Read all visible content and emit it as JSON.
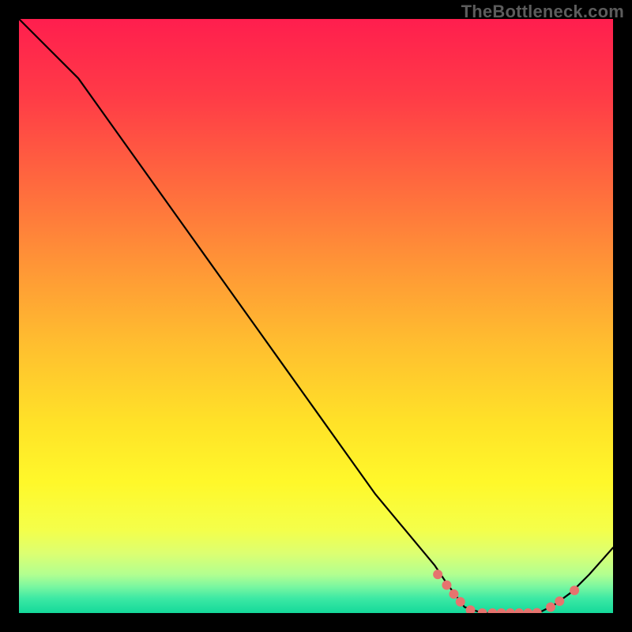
{
  "watermark": "TheBottleneck.com",
  "chart_data": {
    "type": "line",
    "title": "",
    "xlabel": "",
    "ylabel": "",
    "xlim": [
      0,
      100
    ],
    "ylim": [
      0,
      100
    ],
    "grid": false,
    "legend": false,
    "series": [
      {
        "name": "curve",
        "x": [
          0,
          5,
          10,
          15,
          20,
          25,
          30,
          35,
          40,
          45,
          50,
          55,
          60,
          65,
          70,
          72,
          75,
          78,
          80,
          83,
          86,
          88,
          90,
          93,
          96,
          100
        ],
        "y": [
          100,
          95,
          90,
          83,
          76,
          69,
          62,
          55,
          48,
          41,
          34,
          27,
          20,
          14,
          8,
          5,
          1,
          0,
          0,
          0,
          0,
          0.3,
          1.3,
          3.5,
          6.5,
          11
        ]
      }
    ],
    "highlight_points": {
      "name": "highlight-dots",
      "color": "#e6736e",
      "points": [
        {
          "x": 70.5,
          "y": 6.5
        },
        {
          "x": 72.0,
          "y": 4.7
        },
        {
          "x": 73.2,
          "y": 3.2
        },
        {
          "x": 74.3,
          "y": 1.9
        },
        {
          "x": 76.0,
          "y": 0.5
        },
        {
          "x": 78.0,
          "y": 0.0
        },
        {
          "x": 79.7,
          "y": 0.0
        },
        {
          "x": 81.2,
          "y": 0.0
        },
        {
          "x": 82.7,
          "y": 0.0
        },
        {
          "x": 84.2,
          "y": 0.0
        },
        {
          "x": 85.7,
          "y": 0.0
        },
        {
          "x": 87.2,
          "y": 0.05
        },
        {
          "x": 89.5,
          "y": 1.0
        },
        {
          "x": 91.0,
          "y": 2.0
        },
        {
          "x": 93.5,
          "y": 3.8
        }
      ]
    },
    "gradient_stops": [
      {
        "offset": 0.0,
        "color": "#ff1e4e"
      },
      {
        "offset": 0.13,
        "color": "#ff3b47"
      },
      {
        "offset": 0.28,
        "color": "#ff6a3e"
      },
      {
        "offset": 0.42,
        "color": "#ff9736"
      },
      {
        "offset": 0.55,
        "color": "#ffbf2f"
      },
      {
        "offset": 0.68,
        "color": "#ffe228"
      },
      {
        "offset": 0.78,
        "color": "#fff82a"
      },
      {
        "offset": 0.86,
        "color": "#f4ff4a"
      },
      {
        "offset": 0.9,
        "color": "#dcff72"
      },
      {
        "offset": 0.935,
        "color": "#b2ff90"
      },
      {
        "offset": 0.955,
        "color": "#7cf7a0"
      },
      {
        "offset": 0.975,
        "color": "#3de9a4"
      },
      {
        "offset": 1.0,
        "color": "#14d99a"
      }
    ]
  }
}
